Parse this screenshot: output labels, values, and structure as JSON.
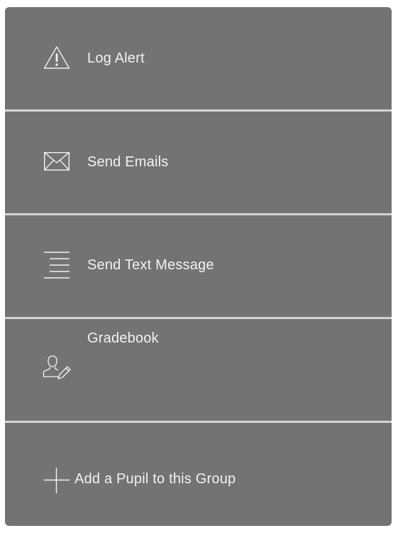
{
  "menu": {
    "items": [
      {
        "label": "Log Alert",
        "icon": "warning-icon"
      },
      {
        "label": "Send Emails",
        "icon": "envelope-icon"
      },
      {
        "label": "Send Text Message",
        "icon": "text-lines-icon"
      },
      {
        "label": "Gradebook",
        "icon": "user-edit-icon"
      },
      {
        "label": "Add a Pupil to this Group",
        "icon": "plus-icon"
      }
    ]
  },
  "colors": {
    "item_background": "#737373",
    "divider": "#d4d4d4",
    "text": "#f2f2f2"
  }
}
